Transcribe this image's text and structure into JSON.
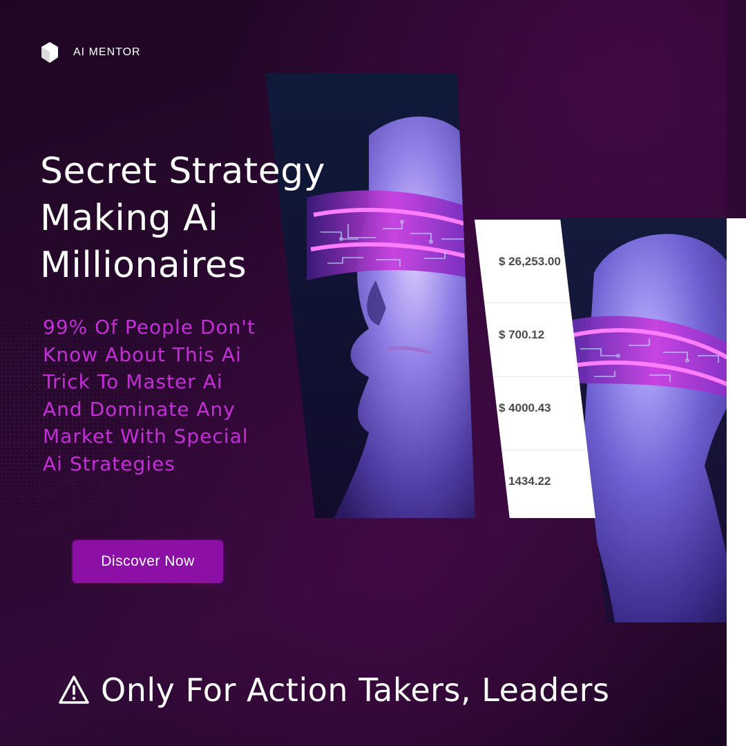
{
  "brand": {
    "name": "AI MENTOR",
    "logo_icon": "cube-logo-icon"
  },
  "headline": {
    "line1": "Secret Strategy",
    "line2": "Making Ai",
    "line3": "Millionaires"
  },
  "subheadline": {
    "lines": [
      "99% Of People Don't",
      "Know About This Ai",
      "Trick To Master Ai",
      "And Dominate Any",
      "Market With Special",
      "Ai Strategies"
    ]
  },
  "cta": {
    "label": "Discover Now"
  },
  "earnings": {
    "values": [
      "$ 26,253.00",
      "$ 700.12",
      "$ 4000.43",
      "1434.22"
    ]
  },
  "footer": {
    "icon": "warning-icon",
    "text": "Only For Action Takers, Leaders"
  },
  "colors": {
    "background": "#2a0830",
    "accent": "#c42fd8",
    "button": "#8d10a6",
    "text": "#ffffff"
  }
}
